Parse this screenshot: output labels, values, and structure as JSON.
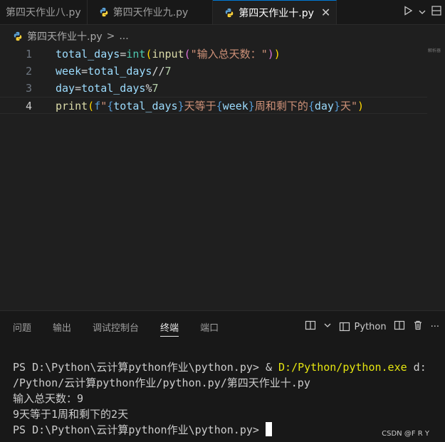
{
  "tabs": [
    {
      "label": "第四天作业八.py"
    },
    {
      "label": "第四天作业九.py"
    },
    {
      "label": "第四天作业十.py",
      "active": true
    }
  ],
  "breadcrumb": {
    "file": "第四天作业十.py",
    "sep": ">",
    "more": "..."
  },
  "editor": {
    "lines": [
      {
        "num": "1"
      },
      {
        "num": "2"
      },
      {
        "num": "3"
      },
      {
        "num": "4"
      }
    ],
    "minimap_text": "解析器"
  },
  "panel": {
    "tabs": [
      "问题",
      "输出",
      "调试控制台",
      "终端",
      "端口"
    ],
    "active_tab": "终端",
    "terminal_name": "Python",
    "more": "···"
  },
  "terminal": {
    "line1_prompt": "PS D:\\Python\\云计算python作业\\python.py> & ",
    "line1_exe": "D:/Python/python.exe",
    "line1_arg": " d:",
    "line2": "/Python/云计算python作业/python.py/第四天作业十.py",
    "line3": "输入总天数：9",
    "line4": "9天等于1周和剩下的2天",
    "line5_prompt": "PS D:\\Python\\云计算python作业\\python.py> "
  },
  "watermark": "CSDN @F R  Y",
  "colors": {
    "accent": "#0078d4",
    "background": "#1f1f1f",
    "panel": "#181818"
  }
}
